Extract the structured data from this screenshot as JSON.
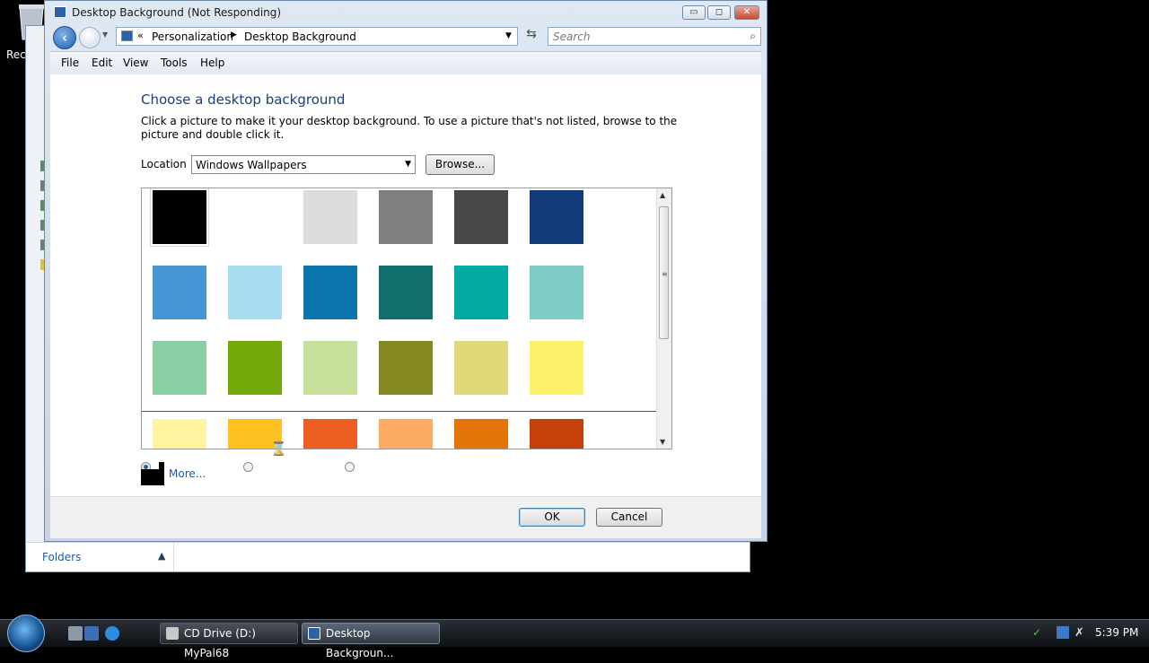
{
  "desktop": {
    "recycle_bin_label": "Recy"
  },
  "window": {
    "title": "Desktop Background (Not Responding)",
    "buttons": {
      "minimize": "▭",
      "maximize": "◻",
      "close": "✕"
    }
  },
  "address": {
    "chevron": "«",
    "crumbs": [
      "Personalization",
      "Desktop Background"
    ],
    "search_placeholder": "Search"
  },
  "menu": [
    "File",
    "Edit",
    "View",
    "Tools",
    "Help"
  ],
  "content": {
    "heading": "Choose a desktop background",
    "description": "Click a picture to make it your desktop background. To use a picture that's not listed, browse to the picture and double click it.",
    "location_label": "Location",
    "location_value": "Windows Wallpapers",
    "browse_label": "Browse...",
    "more_label": "More...",
    "tiles": [
      "#000000",
      "#ffffff",
      "#dcdcdc",
      "#7f7f7f",
      "#474747",
      "#103a7a",
      "#4796d4",
      "#a7dbf0",
      "#0b77ae",
      "#106e6c",
      "#00aaa0",
      "#7dcdc4",
      "#8acfa3",
      "#73a90a",
      "#c6e09c",
      "#848a21",
      "#dfd878",
      "#fdf06a",
      "#fdf3a1",
      "#fdc220",
      "#ee5d21",
      "#fbab64",
      "#e57508",
      "#c5400b"
    ]
  },
  "footer": {
    "ok_label": "OK",
    "cancel_label": "Cancel"
  },
  "explorer": {
    "folders_label": "Folders"
  },
  "taskbar": {
    "tasks": [
      "CD Drive (D:) MyPal68",
      "Desktop Backgroun..."
    ],
    "clock": "5:39 PM"
  }
}
